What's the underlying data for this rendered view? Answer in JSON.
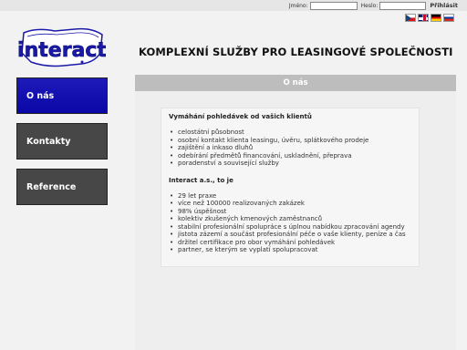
{
  "login": {
    "name_label": "Jméno:",
    "name_value": "",
    "password_label": "Heslo:",
    "password_value": "",
    "submit_label": "Přihlásit"
  },
  "languages": [
    "czech-flag-icon",
    "english-flag-icon",
    "german-flag-icon",
    "russian-flag-icon"
  ],
  "header": {
    "logo_text": "interact",
    "tagline": "KOMPLEXNÍ SLUŽBY PRO LEASINGOVÉ SPOLEČNOSTI"
  },
  "nav": {
    "items": [
      {
        "label": "O nás",
        "active": true
      },
      {
        "label": "Kontakty",
        "active": false
      },
      {
        "label": "Reference",
        "active": false
      }
    ]
  },
  "colors": {
    "nav_active": "#1a17b5",
    "nav_inactive": "#474747",
    "section_bar": "#bdbdbd",
    "logo_blue": "#1a1aa8"
  },
  "section": {
    "title": "O nás",
    "block1": {
      "heading": "Vymáhání pohledávek od vašich klientů",
      "items": [
        "celostátní působnost",
        "osobní kontakt klienta leasingu, úvěru, splátkového prodeje",
        "zajištění a inkaso dluhů",
        "odebírání předmětů financování, uskladnění, přeprava",
        "poradenství a související služby"
      ]
    },
    "block2": {
      "heading": "Interact a.s., to je",
      "items": [
        "29 let praxe",
        "více než 100000 realizovaných zakázek",
        "98% úspěšnost",
        "kolektiv zkušených kmenových zaměstnanců",
        "stabilní profesionální spolupráce s úplnou nabídkou zpracování agendy",
        "jistota zázemí a součást profesionální péče o vaše klienty, peníze a čas",
        "držitel certifikace pro obor vymáhání pohledávek",
        "partner, se kterým se vyplatí spolupracovat"
      ]
    }
  }
}
